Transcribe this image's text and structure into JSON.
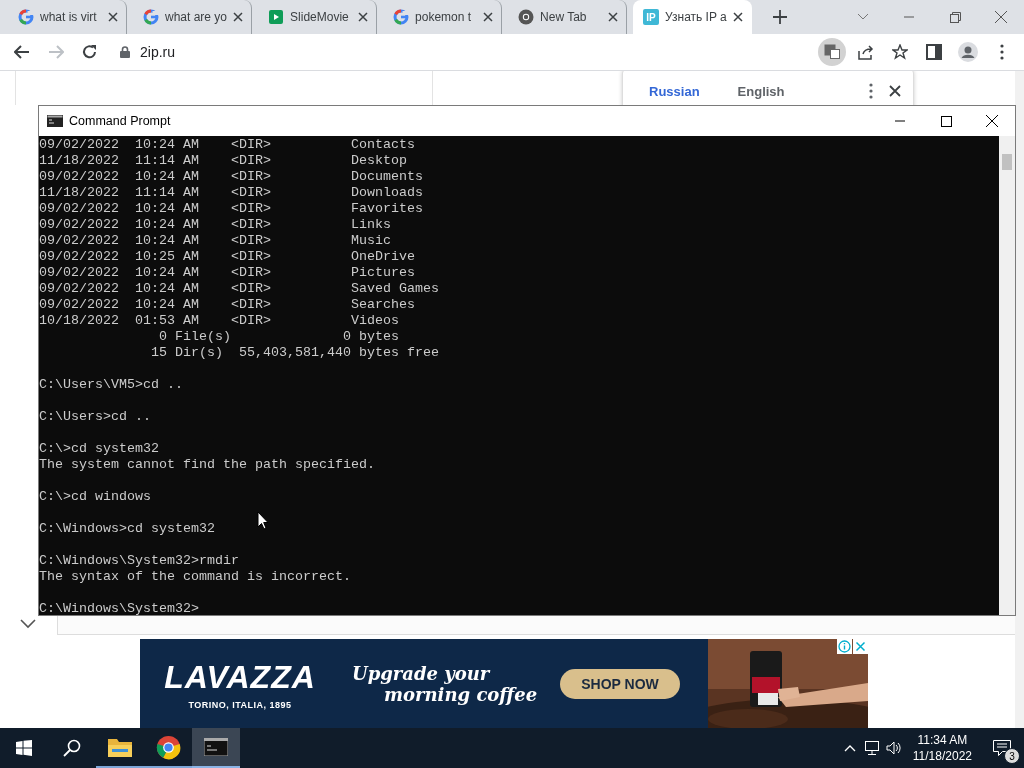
{
  "browser": {
    "tabs": [
      {
        "title": "what is virt",
        "kind": "google",
        "selected": false
      },
      {
        "title": "what are yo",
        "kind": "google",
        "selected": false
      },
      {
        "title": "SlideMovie",
        "kind": "slides",
        "selected": false
      },
      {
        "title": "pokemon t",
        "kind": "google",
        "selected": false
      },
      {
        "title": "New Tab",
        "kind": "chrome",
        "selected": false
      },
      {
        "title": "Узнать IP а",
        "kind": "ip",
        "badge": "IP",
        "selected": true
      }
    ],
    "address": "2ip.ru"
  },
  "translate_bar": {
    "languages": [
      {
        "label": "Russian",
        "selected": true
      },
      {
        "label": "English",
        "selected": false
      }
    ]
  },
  "command_prompt": {
    "title": "Command Prompt",
    "blocks": [
      [
        "09/02/2022  10:24 AM    <DIR>          Contacts",
        "11/18/2022  11:14 AM    <DIR>          Desktop",
        "09/02/2022  10:24 AM    <DIR>          Documents",
        "11/18/2022  11:14 AM    <DIR>          Downloads",
        "09/02/2022  10:24 AM    <DIR>          Favorites",
        "09/02/2022  10:24 AM    <DIR>          Links",
        "09/02/2022  10:24 AM    <DIR>          Music",
        "09/02/2022  10:25 AM    <DIR>          OneDrive",
        "09/02/2022  10:24 AM    <DIR>          Pictures",
        "09/02/2022  10:24 AM    <DIR>          Saved Games",
        "09/02/2022  10:24 AM    <DIR>          Searches",
        "10/18/2022  01:53 AM    <DIR>          Videos",
        "               0 File(s)              0 bytes",
        "              15 Dir(s)  55,403,581,440 bytes free"
      ],
      [
        "C:\\Users\\VM5>cd .."
      ],
      [
        "C:\\Users>cd .."
      ],
      [
        "C:\\>cd system32",
        "The system cannot find the path specified."
      ],
      [
        "C:\\>cd windows"
      ],
      [
        "C:\\Windows>cd system32"
      ],
      [
        "C:\\Windows\\System32>rmdir",
        "The syntax of the command is incorrect."
      ],
      [
        "C:\\Windows\\System32>"
      ]
    ]
  },
  "ad": {
    "brand": "LAVAZZA",
    "tagline": "TORINO, ITALIA, 1895",
    "headline": [
      "Upgrade your",
      "morning coffee"
    ],
    "button": "SHOP NOW"
  },
  "taskbar": {
    "apps": [
      {
        "kind": "explorer",
        "selected": false
      },
      {
        "kind": "chrome",
        "selected": false
      },
      {
        "kind": "cmd",
        "selected": true
      }
    ],
    "time": "11:34 AM",
    "date": "11/18/2022",
    "notifications": "3"
  }
}
